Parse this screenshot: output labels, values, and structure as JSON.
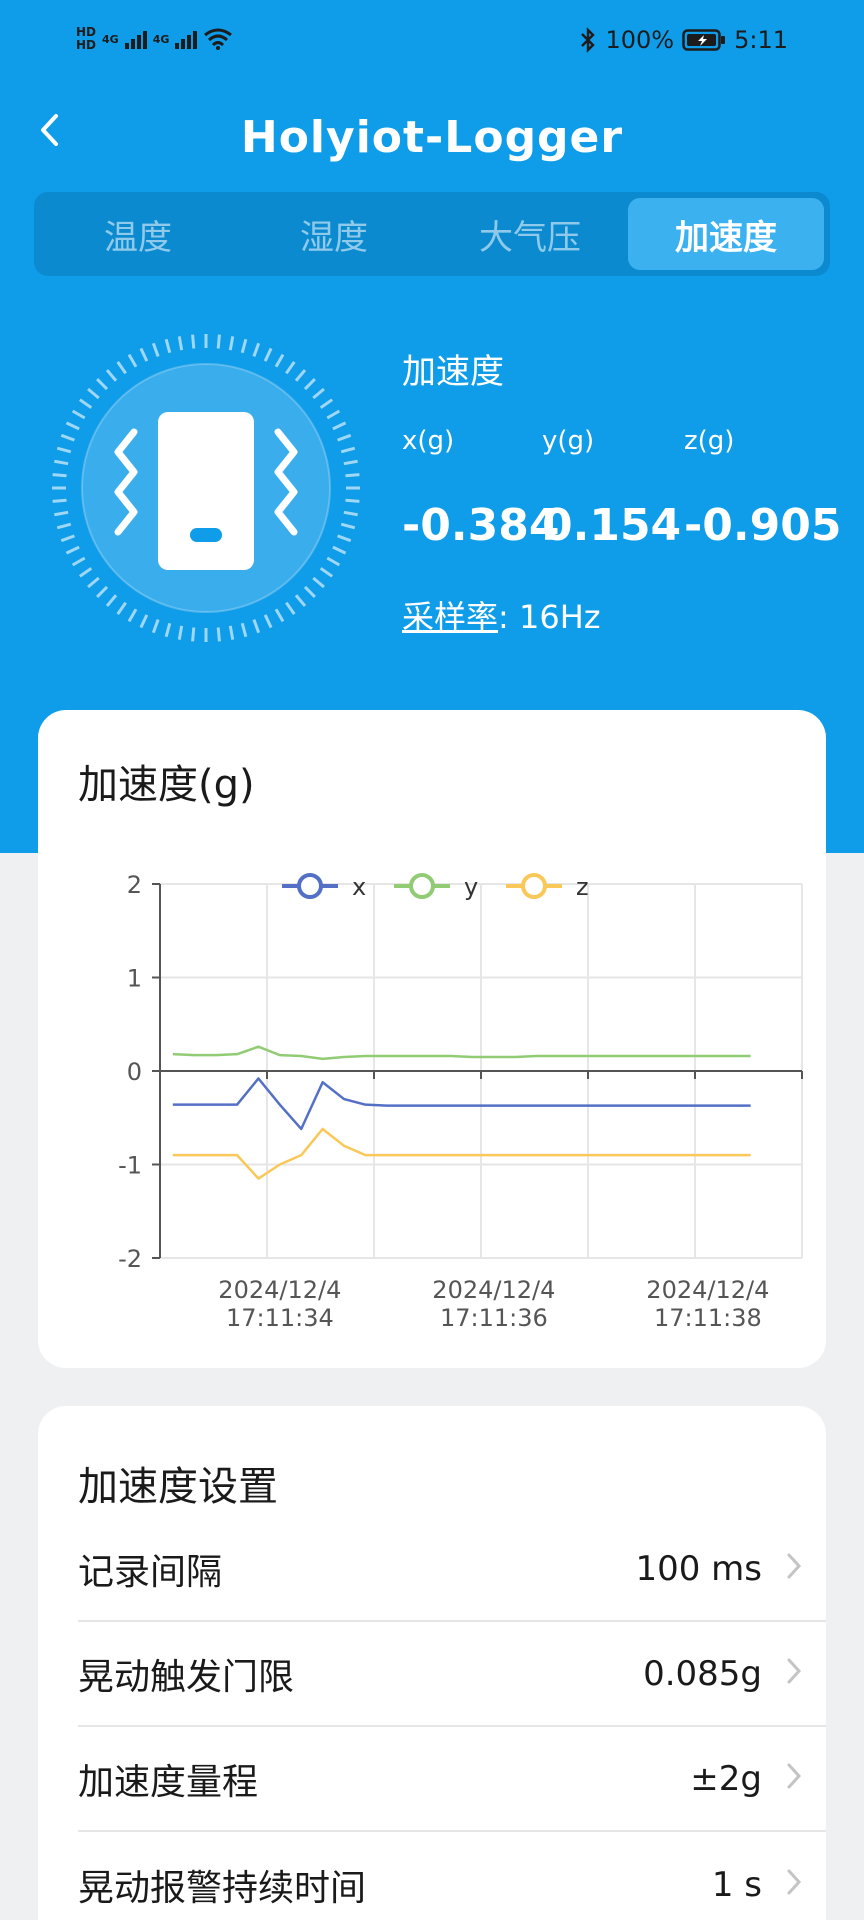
{
  "status_bar": {
    "hd1": "HD",
    "hd2": "HD",
    "sig1": "4G",
    "sig2": "4G",
    "battery": "100%",
    "time": "5:11"
  },
  "header": {
    "title": "Holyiot-Logger"
  },
  "tabs": [
    {
      "label": "温度"
    },
    {
      "label": "湿度"
    },
    {
      "label": "大气压"
    },
    {
      "label": "加速度"
    }
  ],
  "active_tab": "加速度",
  "sensor": {
    "label": "加速度",
    "axes": [
      {
        "name": "x(g)",
        "value": "-0.384"
      },
      {
        "name": "y(g)",
        "value": "0.154"
      },
      {
        "name": "z(g)",
        "value": "-0.905"
      }
    ],
    "rate_label": "采样率",
    "rate_value": ": 16Hz"
  },
  "chart_card": {
    "title": "加速度(g)"
  },
  "chart_data": {
    "type": "line",
    "ylim": [
      -2,
      2
    ],
    "y_ticks": [
      2,
      1,
      0,
      -1,
      -2
    ],
    "x_tick_labels": [
      [
        "2024/12/4",
        "17:11:34"
      ],
      [
        "2024/12/4",
        "17:11:36"
      ],
      [
        "2024/12/4",
        "17:11:38"
      ]
    ],
    "x_tick_index": [
      5,
      15,
      25
    ],
    "series": [
      {
        "name": "x",
        "color": "#5470c6",
        "values": [
          -0.36,
          -0.36,
          -0.36,
          -0.36,
          -0.08,
          -0.36,
          -0.62,
          -0.12,
          -0.3,
          -0.36,
          -0.37,
          -0.37,
          -0.37,
          -0.37,
          -0.37,
          -0.37,
          -0.37,
          -0.37,
          -0.37,
          -0.37,
          -0.37,
          -0.37,
          -0.37,
          -0.37,
          -0.37,
          -0.37,
          -0.37,
          -0.37
        ]
      },
      {
        "name": "y",
        "color": "#91cc75",
        "values": [
          0.18,
          0.17,
          0.17,
          0.18,
          0.26,
          0.17,
          0.16,
          0.13,
          0.15,
          0.16,
          0.16,
          0.16,
          0.16,
          0.16,
          0.15,
          0.15,
          0.15,
          0.16,
          0.16,
          0.16,
          0.16,
          0.16,
          0.16,
          0.16,
          0.16,
          0.16,
          0.16,
          0.16
        ]
      },
      {
        "name": "z",
        "color": "#fac858",
        "values": [
          -0.9,
          -0.9,
          -0.9,
          -0.9,
          -1.15,
          -1.0,
          -0.9,
          -0.62,
          -0.8,
          -0.9,
          -0.9,
          -0.9,
          -0.9,
          -0.9,
          -0.9,
          -0.9,
          -0.9,
          -0.9,
          -0.9,
          -0.9,
          -0.9,
          -0.9,
          -0.9,
          -0.9,
          -0.9,
          -0.9,
          -0.9,
          -0.9
        ]
      }
    ],
    "grid": true,
    "legend": "top-center"
  },
  "settings": {
    "title": "加速度设置",
    "rows": [
      {
        "label": "记录间隔",
        "value": "100 ms"
      },
      {
        "label": "晃动触发门限",
        "value": "0.085g"
      },
      {
        "label": "加速度量程",
        "value": "±2g"
      },
      {
        "label": "晃动报警持续时间",
        "value": "1 s"
      }
    ]
  }
}
